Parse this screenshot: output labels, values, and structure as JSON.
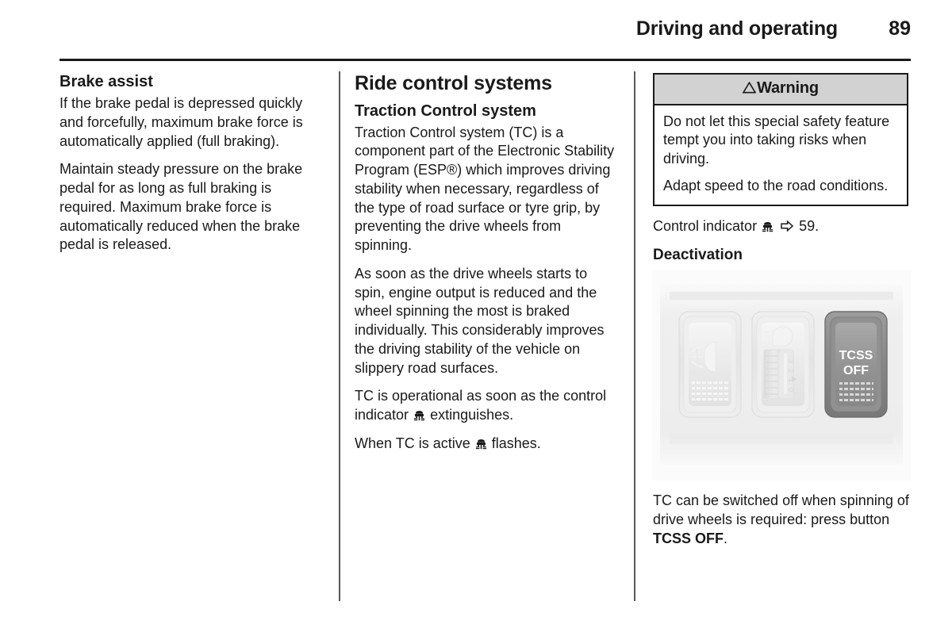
{
  "header": {
    "title": "Driving and operating",
    "page_number": "89"
  },
  "column1": {
    "heading": "Brake assist",
    "paragraphs": [
      "If the brake pedal is depressed quickly and forcefully, maximum brake force is automatically applied (full braking).",
      "Maintain steady pressure on the brake pedal for as long as full braking is required. Maximum brake force is automatically reduced when the brake pedal is released."
    ]
  },
  "column2": {
    "section_heading": "Ride control systems",
    "sub_heading": "Traction Control system",
    "paragraph1": "Traction Control system (TC) is a component part of the Electronic Stability Program (ESP®) which improves driving stability when necessary, regardless of the type of road surface or tyre grip, by preventing the drive wheels from spinning.",
    "paragraph2": "As soon as the drive wheels starts to spin, engine output is reduced and the wheel spinning the most is braked individually. This considerably improves the driving stability of the vehicle on slippery road surfaces.",
    "paragraph3_before": "TC is operational as soon as the control indicator",
    "paragraph3_after": "extinguishes.",
    "paragraph4_before": "When TC is active",
    "paragraph4_after": "flashes."
  },
  "column3": {
    "warning": {
      "title": "Warning",
      "paragraphs": [
        "Do not let this special safety feature tempt you into taking risks when driving.",
        "Adapt speed to the road conditions."
      ]
    },
    "control_indicator": {
      "label": "Control indicator",
      "page_ref": "59."
    },
    "deactivation_heading": "Deactivation",
    "figure": {
      "switch_left_name": "rear-fog-light-switch",
      "switch_middle_name": "headlight-range-adjustment-switch",
      "switch_right_label_line1": "TCSS",
      "switch_right_label_line2": "OFF"
    },
    "caption_before": "TC can be switched off when spinning of drive wheels is required: press button ",
    "caption_bold": "TCSS OFF",
    "caption_after": "."
  },
  "colors": {
    "text": "#1a1a1a",
    "rule": "#5a5a5a",
    "warning_header_bg": "#d2d2d2",
    "panel_bg": "#f2f2f2",
    "switch_inactive": "#e8e8e8",
    "switch_active": "#8a8a8a"
  }
}
